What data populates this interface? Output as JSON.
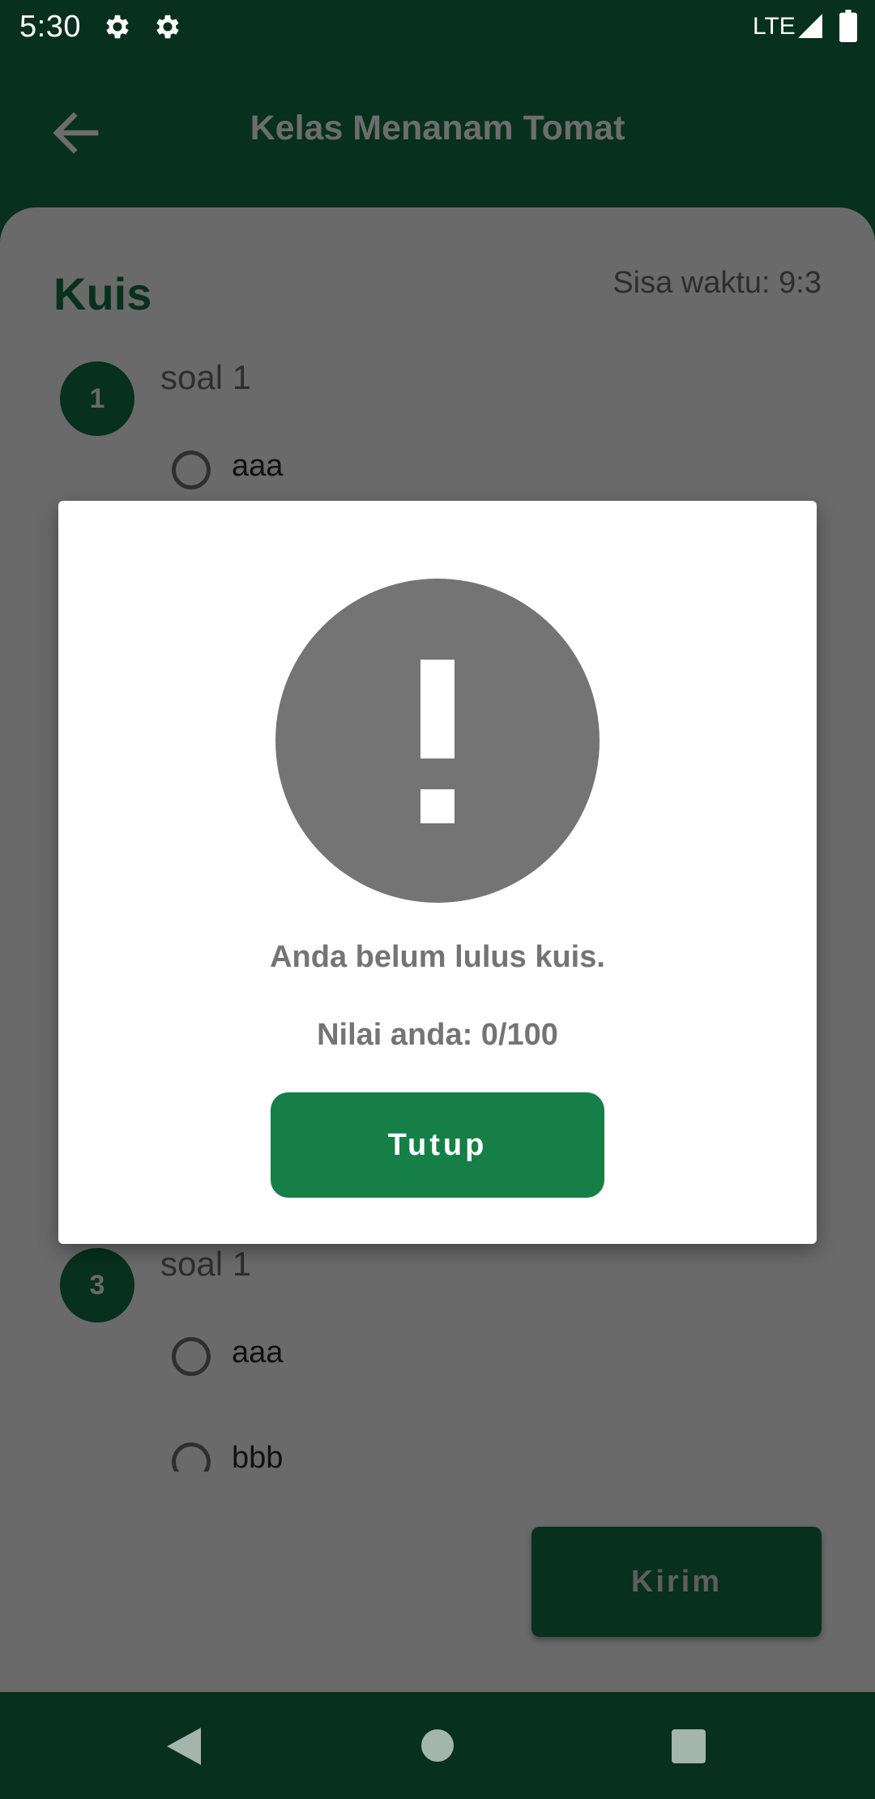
{
  "status_bar": {
    "time": "5:30",
    "network": "LTE",
    "icons": [
      "gear-icon",
      "gear-icon",
      "signal-icon",
      "battery-icon"
    ]
  },
  "app_bar": {
    "title": "Kelas Menanam Tomat",
    "back_icon": "arrow-left-icon"
  },
  "quiz": {
    "heading": "Kuis",
    "timer": "Sisa waktu: 9:3",
    "questions": [
      {
        "number": "1",
        "text": "soal 1",
        "options": [
          "aaa"
        ]
      },
      {
        "number": "3",
        "text": "soal 1",
        "options": [
          "aaa",
          "bbb"
        ]
      }
    ],
    "submit_label": "Kirim"
  },
  "dialog": {
    "icon": "exclamation-circle-icon",
    "message": "Anda belum lulus kuis.",
    "score": "Nilai anda: 0/100",
    "close_label": "Tutup"
  },
  "colors": {
    "app_bar": "#07301e",
    "card_dimmed": "#6a6a6a",
    "dialog_button": "#157f47",
    "dialog_text": "#747474"
  },
  "nav_bar": {
    "icons": [
      "back-triangle-icon",
      "home-circle-icon",
      "recents-square-icon"
    ]
  }
}
